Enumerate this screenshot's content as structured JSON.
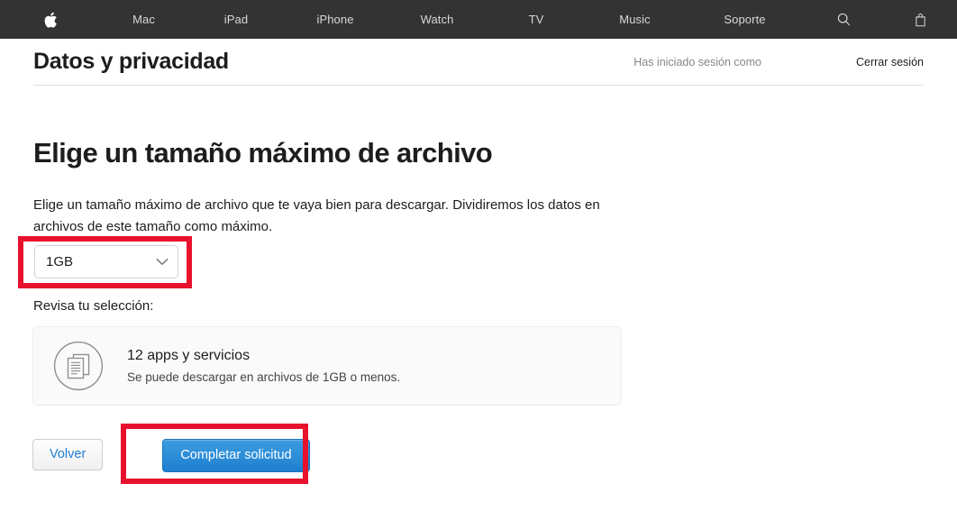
{
  "globalnav": {
    "apple_logo": "apple-logo",
    "items": [
      {
        "label": "Mac",
        "name": "mac"
      },
      {
        "label": "iPad",
        "name": "ipad"
      },
      {
        "label": "iPhone",
        "name": "iphone"
      },
      {
        "label": "Watch",
        "name": "watch"
      },
      {
        "label": "TV",
        "name": "tv"
      },
      {
        "label": "Music",
        "name": "music"
      },
      {
        "label": "Soporte",
        "name": "soporte"
      }
    ],
    "search_icon": "search-icon",
    "bag_icon": "shopping-bag-icon",
    "background": "#333333"
  },
  "header": {
    "title": "Datos y privacidad",
    "signed_in_as": "Has iniciado sesión como",
    "sign_out": "Cerrar sesión"
  },
  "main": {
    "section_title": "Elige un tamaño máximo de archivo",
    "intro": "Elige un tamaño máximo de archivo que te vaya bien para descargar. Dividiremos los datos en archivos de este tamaño como máximo.",
    "file_size_select": {
      "value": "1GB",
      "chevron_icon": "chevron-down-icon"
    },
    "review_label": "Revisa tu selección:",
    "summary_card": {
      "icon": "documents-icon",
      "title": "12 apps y servicios",
      "subtitle": "Se puede descargar en archivos de 1GB o menos."
    },
    "buttons": {
      "back": "Volver",
      "submit": "Completar solicitud"
    }
  },
  "annotations": {
    "color": "#e8112d",
    "boxes": [
      {
        "name": "highlight-file-size-select"
      },
      {
        "name": "highlight-submit-button"
      }
    ]
  }
}
